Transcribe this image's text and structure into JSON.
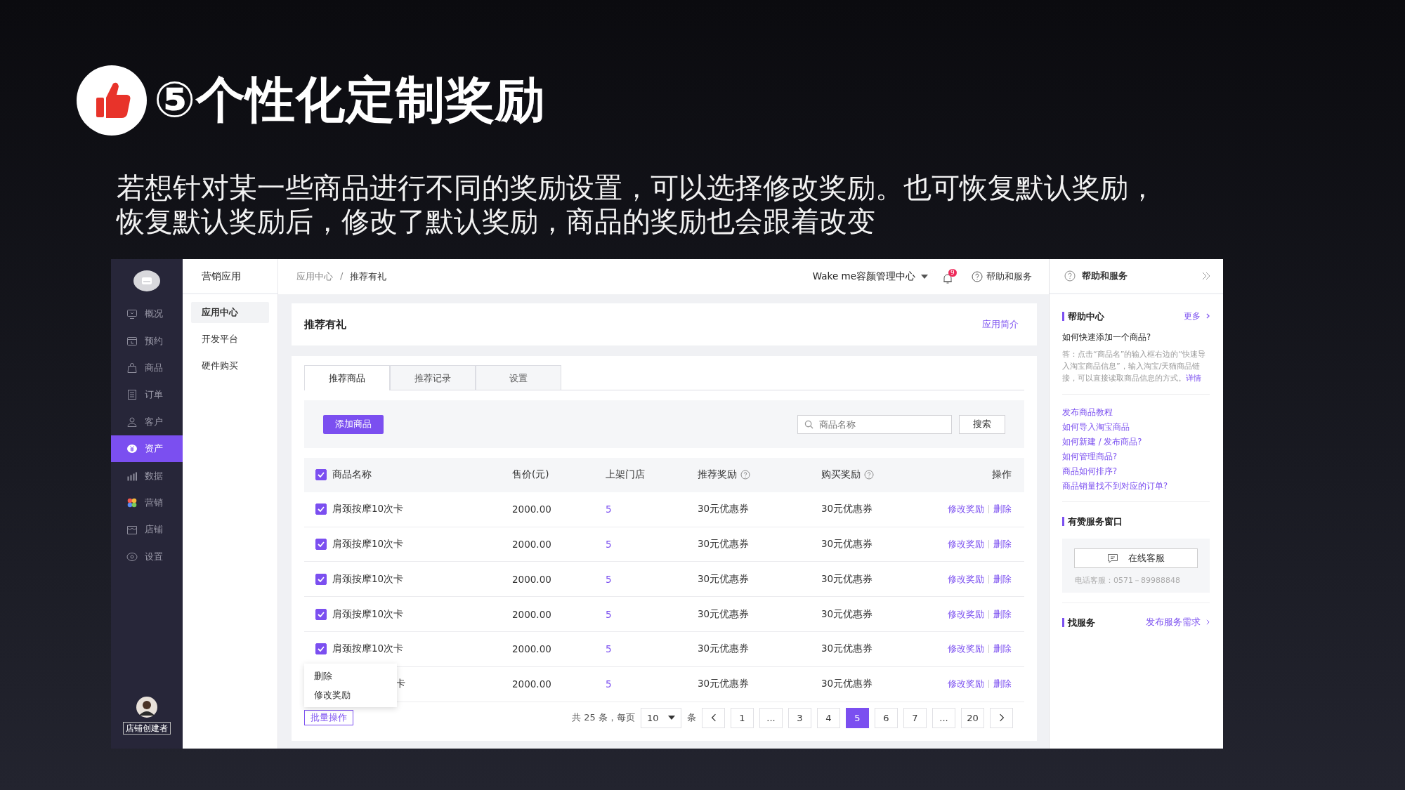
{
  "slide": {
    "title": "⑤个性化定制奖励",
    "lines": [
      "若想针对某一些商品进行不同的奖励设置，可以选择修改奖励。也可恢复默认奖励，",
      "恢复默认奖励后，修改了默认奖励，商品的奖励也会跟着改变"
    ]
  },
  "sidebar": {
    "items": [
      {
        "label": "概况",
        "selected": false
      },
      {
        "label": "预约",
        "selected": false
      },
      {
        "label": "商品",
        "selected": false
      },
      {
        "label": "订单",
        "selected": false
      },
      {
        "label": "客户",
        "selected": false
      },
      {
        "label": "资产",
        "selected": true
      },
      {
        "label": "数据",
        "selected": false
      },
      {
        "label": "营销",
        "selected": false
      },
      {
        "label": "店铺",
        "selected": false
      },
      {
        "label": "设置",
        "selected": false
      }
    ],
    "user_label": "店铺创建者"
  },
  "subnav": {
    "title": "营销应用",
    "items": [
      {
        "label": "应用中心",
        "selected": true
      },
      {
        "label": "开发平台",
        "selected": false
      },
      {
        "label": "硬件购买",
        "selected": false
      }
    ]
  },
  "topbar": {
    "breadcrumb": [
      "应用中心",
      "推荐有礼"
    ],
    "breadcrumb_separator": "/",
    "store": "Wake me容颜管理中心",
    "notifications": "9",
    "help": "帮助和服务"
  },
  "page": {
    "title": "推荐有礼",
    "intro_link": "应用简介"
  },
  "tabs": [
    {
      "label": "推荐商品",
      "selected": true
    },
    {
      "label": "推荐记录",
      "selected": false
    },
    {
      "label": "设置",
      "selected": false
    }
  ],
  "toolbar": {
    "add_button": "添加商品",
    "search_placeholder": "商品名称",
    "search_button": "搜索"
  },
  "table": {
    "select_all_checked": true,
    "columns": [
      {
        "label": "商品名称",
        "help": false
      },
      {
        "label": "售价(元)",
        "help": false
      },
      {
        "label": "上架门店",
        "help": false
      },
      {
        "label": "推荐奖励",
        "help": true
      },
      {
        "label": "购买奖励",
        "help": true
      },
      {
        "label": "操作",
        "help": false
      }
    ],
    "rows": [
      {
        "checked": true,
        "name": "肩颈按摩10次卡",
        "price": "2000.00",
        "stores": "5",
        "referral_reward": "30元优惠券",
        "purchase_reward": "30元优惠券",
        "actions": [
          "修改奖励",
          "删除"
        ]
      },
      {
        "checked": true,
        "name": "肩颈按摩10次卡",
        "price": "2000.00",
        "stores": "5",
        "referral_reward": "30元优惠券",
        "purchase_reward": "30元优惠券",
        "actions": [
          "修改奖励",
          "删除"
        ]
      },
      {
        "checked": true,
        "name": "肩颈按摩10次卡",
        "price": "2000.00",
        "stores": "5",
        "referral_reward": "30元优惠券",
        "purchase_reward": "30元优惠券",
        "actions": [
          "修改奖励",
          "删除"
        ]
      },
      {
        "checked": true,
        "name": "肩颈按摩10次卡",
        "price": "2000.00",
        "stores": "5",
        "referral_reward": "30元优惠券",
        "purchase_reward": "30元优惠券",
        "actions": [
          "修改奖励",
          "删除"
        ]
      },
      {
        "checked": true,
        "name": "肩颈按摩10次卡",
        "price": "2000.00",
        "stores": "5",
        "referral_reward": "30元优惠券",
        "purchase_reward": "30元优惠券",
        "actions": [
          "修改奖励",
          "删除"
        ]
      },
      {
        "name": "卡",
        "price": "2000.00",
        "stores": "5",
        "referral_reward": "30元优惠券",
        "purchase_reward": "30元优惠券",
        "actions": [
          "修改奖励",
          "删除"
        ]
      }
    ]
  },
  "batch": {
    "label": "批量操作",
    "expanded": true,
    "menu": [
      "删除",
      "修改奖励"
    ]
  },
  "pagination": {
    "summary": "共 25 条，每页",
    "page_size": "10",
    "unit": "条",
    "pages": [
      {
        "label": "1",
        "selected": false
      },
      {
        "label": "...",
        "selected": false
      },
      {
        "label": "3",
        "selected": false
      },
      {
        "label": "4",
        "selected": false
      },
      {
        "label": "5",
        "selected": true
      },
      {
        "label": "6",
        "selected": false
      },
      {
        "label": "7",
        "selected": false
      },
      {
        "label": "...",
        "selected": false
      },
      {
        "label": "20",
        "selected": false
      }
    ]
  },
  "help_panel": {
    "title": "帮助和服务",
    "help_center": {
      "title": "帮助中心",
      "more": "更多",
      "question": "如何快速添加一个商品?",
      "answer": "答：点击“商品名”的输入框右边的“快速导入淘宝商品信息”，输入淘宝/天猫商品链接，可以直接读取商品信息的方式。",
      "detail_link": "详情",
      "links": [
        "发布商品教程",
        "如何导入淘宝商品",
        "如何新建 / 发布商品?",
        "如何管理商品?",
        "商品如何排序?",
        "商品销量找不到对应的订单?"
      ]
    },
    "service": {
      "title": "有赞服务窗口",
      "chat_button": "在线客服",
      "phone": "电话客服：0571－89988848"
    },
    "find": {
      "title": "找服务",
      "link": "发布服务需求"
    }
  }
}
